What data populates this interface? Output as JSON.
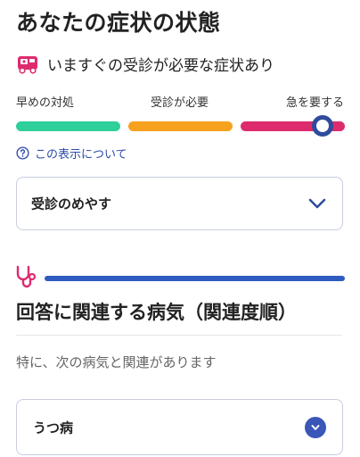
{
  "header": {
    "title": "あなたの症状の状態"
  },
  "status": {
    "icon": "ambulance-icon",
    "text": "いますぐの受診が必要な症状あり",
    "accent_color": "#dd2b6e"
  },
  "urgency_scale": {
    "labels": [
      "早めの対処",
      "受診が必要",
      "急を要する"
    ],
    "colors": [
      "#2fcf9b",
      "#f7a21e",
      "#dd2b6e"
    ],
    "indicator_position_fraction": 0.93
  },
  "about_link": {
    "icon": "help-circle-icon",
    "text": "この表示について"
  },
  "guidance_card": {
    "label": "受診のめやす",
    "icon": "chevron-down-icon"
  },
  "related_diseases": {
    "icon": "stethoscope-icon",
    "title": "回答に関連する病気（関連度順）",
    "subtitle": "特に、次の病気と関連があります",
    "items": [
      {
        "label": "うつ病",
        "icon": "chevron-down-circle-icon"
      }
    ]
  }
}
